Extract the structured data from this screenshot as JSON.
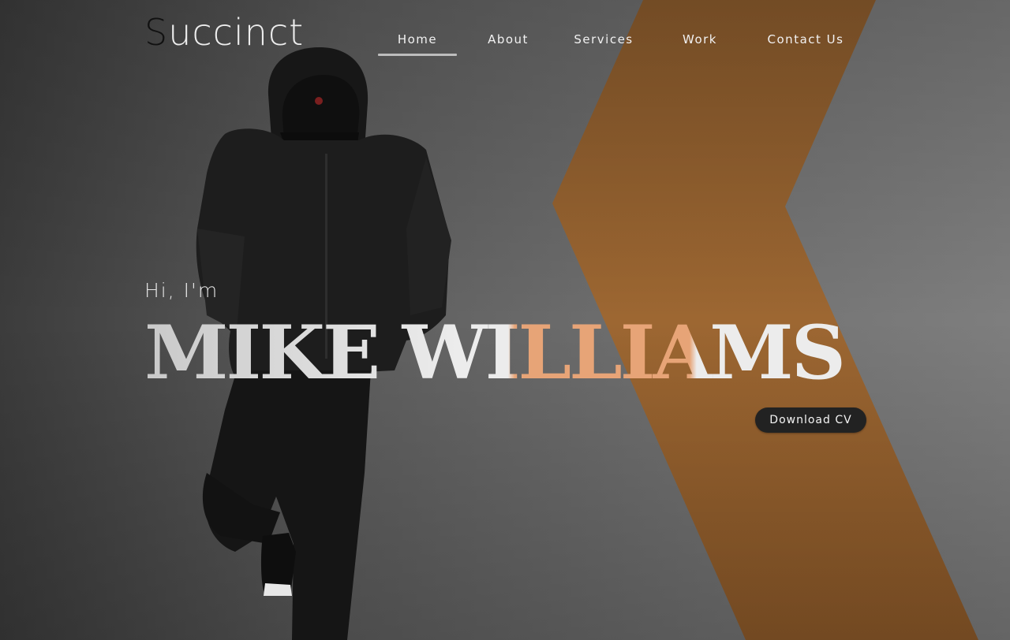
{
  "brand": {
    "first_letter": "S",
    "rest": "uccinct"
  },
  "nav": {
    "items": [
      {
        "label": "Home",
        "active": true
      },
      {
        "label": "About",
        "active": false
      },
      {
        "label": "Services",
        "active": false
      },
      {
        "label": "Work",
        "active": false
      },
      {
        "label": "Contact Us",
        "active": false
      }
    ]
  },
  "hero": {
    "greeting": "Hi, I'm",
    "name": "MIKE WILLIAMS",
    "cta_label": "Download CV",
    "background_description_icon": "person-leaning-on-wall-photo"
  },
  "colors": {
    "accent": "#e7a477",
    "stripe": "#9a6632",
    "name_white": "#ececec",
    "wall": "#6e6e6e"
  }
}
